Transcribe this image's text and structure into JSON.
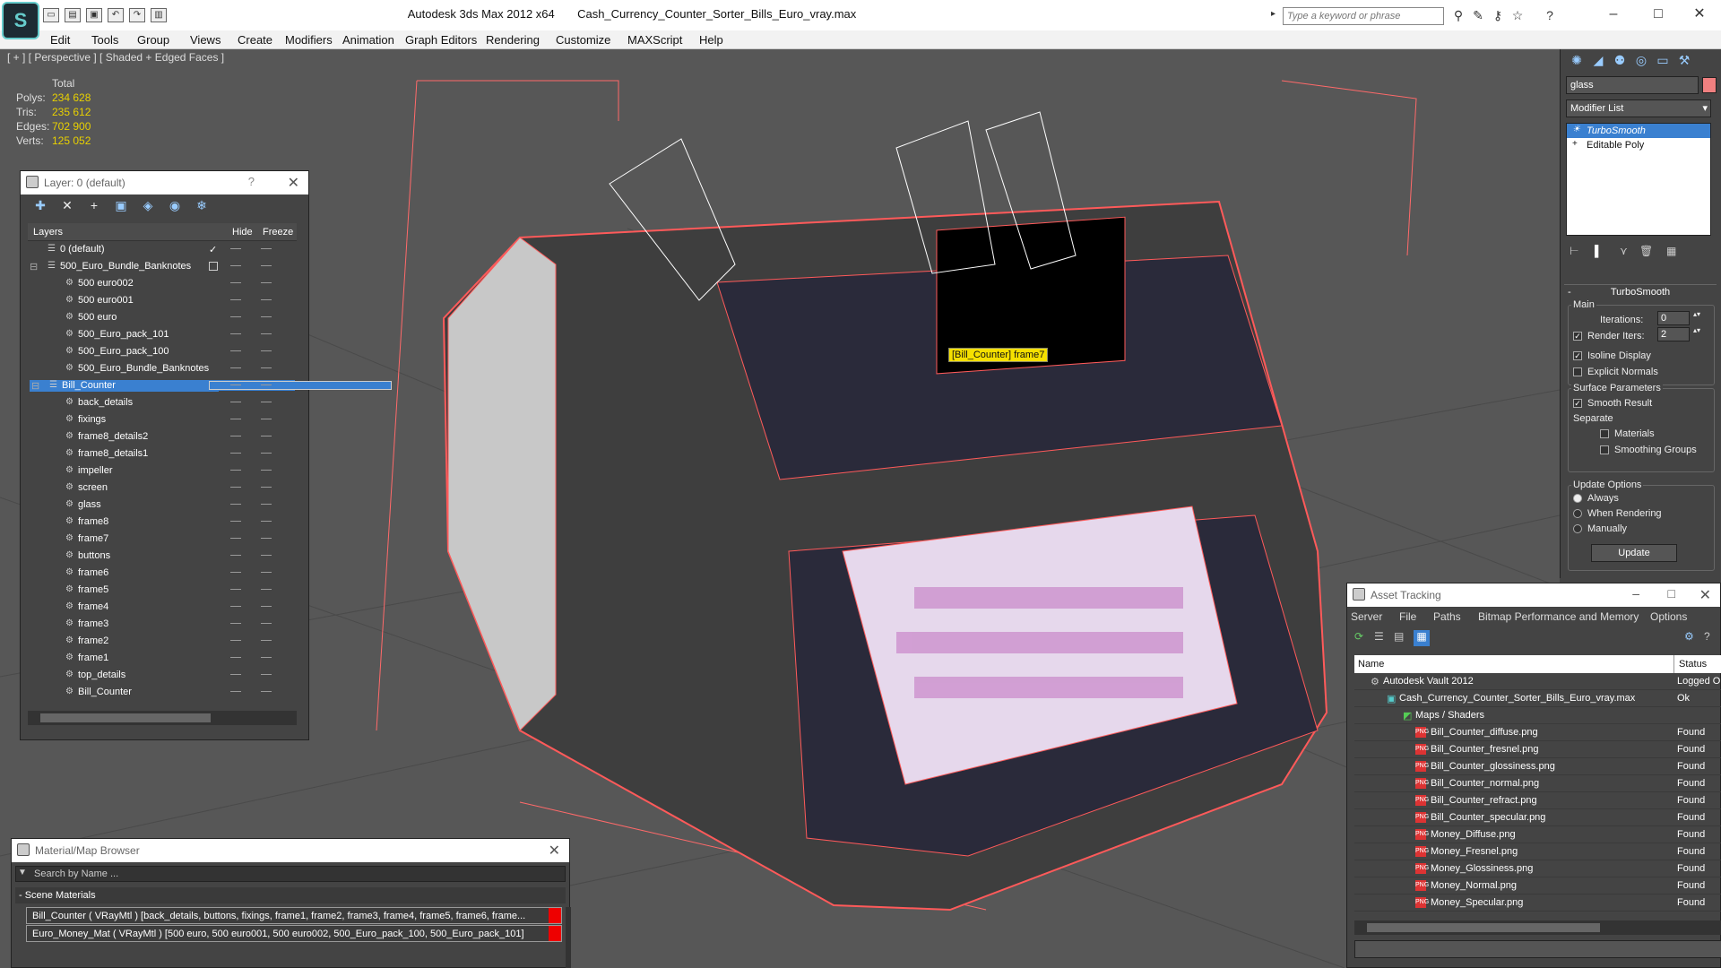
{
  "window": {
    "app_title": "Autodesk 3ds Max  2012 x64",
    "file_title": "Cash_Currency_Counter_Sorter_Bills_Euro_vray.max",
    "search_placeholder": "Type a keyword or phrase"
  },
  "menu": [
    "Edit",
    "Tools",
    "Group",
    "Views",
    "Create",
    "Modifiers",
    "Animation",
    "Graph Editors",
    "Rendering",
    "Customize",
    "MAXScript",
    "Help"
  ],
  "viewport": {
    "label": "[ + ] [ Perspective ] [ Shaded + Edged Faces ]",
    "stats": {
      "header": "Total",
      "rows": [
        {
          "label": "Polys:",
          "value": "234 628"
        },
        {
          "label": "Tris:",
          "value": "235 612"
        },
        {
          "label": "Edges:",
          "value": "702 900"
        },
        {
          "label": "Verts:",
          "value": "125 052"
        }
      ]
    },
    "tooltip": "[Bill_Counter] frame7"
  },
  "layers_panel": {
    "title": "Layer: 0 (default)",
    "help": "?",
    "columns": {
      "layers": "Layers",
      "hide": "Hide",
      "freeze": "Freeze"
    },
    "items": [
      {
        "name": "0 (default)",
        "level": 0
      },
      {
        "name": "500_Euro_Bundle_Banknotes",
        "level": 0
      },
      {
        "name": "500 euro002",
        "level": 1
      },
      {
        "name": "500 euro001",
        "level": 1
      },
      {
        "name": "500 euro",
        "level": 1
      },
      {
        "name": "500_Euro_pack_101",
        "level": 1
      },
      {
        "name": "500_Euro_pack_100",
        "level": 1
      },
      {
        "name": "500_Euro_Bundle_Banknotes",
        "level": 1
      },
      {
        "name": "Bill_Counter",
        "level": 0
      },
      {
        "name": "back_details",
        "level": 1
      },
      {
        "name": "fixings",
        "level": 1
      },
      {
        "name": "frame8_details2",
        "level": 1
      },
      {
        "name": "frame8_details1",
        "level": 1
      },
      {
        "name": "impeller",
        "level": 1
      },
      {
        "name": "screen",
        "level": 1
      },
      {
        "name": "glass",
        "level": 1
      },
      {
        "name": "frame8",
        "level": 1
      },
      {
        "name": "frame7",
        "level": 1
      },
      {
        "name": "buttons",
        "level": 1
      },
      {
        "name": "frame6",
        "level": 1
      },
      {
        "name": "frame5",
        "level": 1
      },
      {
        "name": "frame4",
        "level": 1
      },
      {
        "name": "frame3",
        "level": 1
      },
      {
        "name": "frame2",
        "level": 1
      },
      {
        "name": "frame1",
        "level": 1
      },
      {
        "name": "top_details",
        "level": 1
      },
      {
        "name": "Bill_Counter",
        "level": 1
      }
    ]
  },
  "modifier_panel": {
    "object_name": "glass",
    "modifier_list": "Modifier List",
    "stack": [
      "TurboSmooth",
      "Editable Poly"
    ],
    "rollout_title": "TurboSmooth",
    "main": "Main",
    "iterations_label": "Iterations:",
    "iterations_value": "0",
    "render_iters_label": "Render Iters:",
    "render_iters_value": "2",
    "isoline": "Isoline Display",
    "explicit_normals": "Explicit Normals",
    "surface_params": "Surface Parameters",
    "smooth_result": "Smooth Result",
    "separate": "Separate",
    "materials": "Materials",
    "smoothing_groups": "Smoothing Groups",
    "update_options": "Update Options",
    "always": "Always",
    "when_rendering": "When Rendering",
    "manually": "Manually",
    "update_button": "Update"
  },
  "asset_tracking": {
    "title": "Asset Tracking",
    "menu": [
      "Server",
      "File",
      "Paths",
      "Bitmap Performance and Memory",
      "Options"
    ],
    "columns": {
      "name": "Name",
      "status": "Status"
    },
    "rows": [
      {
        "name": "Autodesk Vault 2012",
        "status": "Logged O"
      },
      {
        "name": "Cash_Currency_Counter_Sorter_Bills_Euro_vray.max",
        "status": "Ok"
      },
      {
        "name": "Maps / Shaders",
        "status": ""
      },
      {
        "name": "Bill_Counter_diffuse.png",
        "status": "Found"
      },
      {
        "name": "Bill_Counter_fresnel.png",
        "status": "Found"
      },
      {
        "name": "Bill_Counter_glossiness.png",
        "status": "Found"
      },
      {
        "name": "Bill_Counter_normal.png",
        "status": "Found"
      },
      {
        "name": "Bill_Counter_refract.png",
        "status": "Found"
      },
      {
        "name": "Bill_Counter_specular.png",
        "status": "Found"
      },
      {
        "name": "Money_Diffuse.png",
        "status": "Found"
      },
      {
        "name": "Money_Fresnel.png",
        "status": "Found"
      },
      {
        "name": "Money_Glossiness.png",
        "status": "Found"
      },
      {
        "name": "Money_Normal.png",
        "status": "Found"
      },
      {
        "name": "Money_Specular.png",
        "status": "Found"
      }
    ]
  },
  "material_browser": {
    "title": "Material/Map Browser",
    "search_placeholder": "Search by Name ...",
    "section": "- Scene Materials",
    "materials": [
      "Bill_Counter  ( VRayMtl ) [back_details, buttons, fixings, frame1, frame2, frame3, frame4, frame5, frame6, frame...",
      "Euro_Money_Mat  ( VRayMtl ) [500 euro, 500 euro001, 500 euro002, 500_Euro_pack_100, 500_Euro_pack_101]"
    ]
  },
  "colors": {
    "accent": "#3a80d0",
    "wire": "#ff5a5a",
    "stats_value": "#e8d000",
    "tooltip": "#f5e000"
  }
}
